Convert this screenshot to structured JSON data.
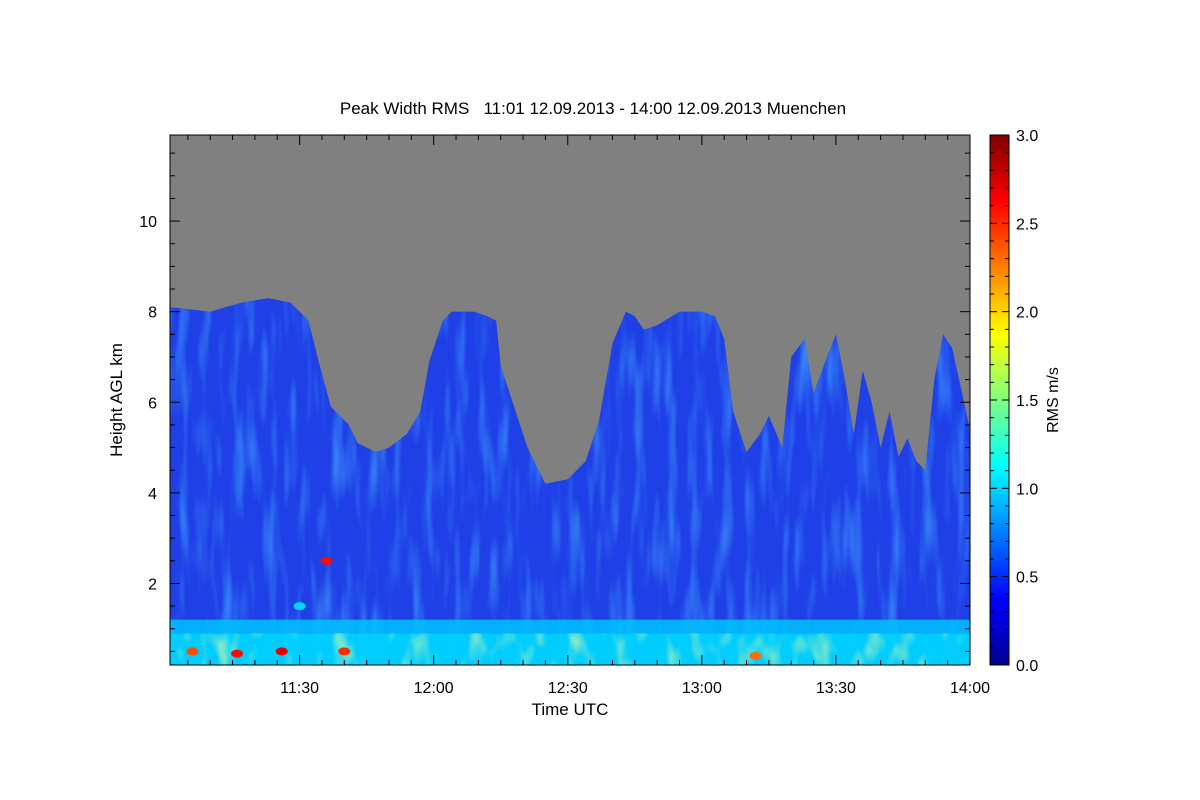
{
  "chart_data": {
    "type": "heatmap",
    "title": "Peak Width RMS   11:01 12.09.2013 - 14:00 12.09.2013 Muenchen",
    "xlabel": "Time UTC",
    "ylabel": "Height AGL km",
    "x_tick_labels": [
      "11:30",
      "12:00",
      "12:30",
      "13:00",
      "13:30",
      "14:00"
    ],
    "x_ticks_minutes": [
      690,
      720,
      750,
      780,
      810,
      840
    ],
    "xlim_minutes": [
      661,
      840
    ],
    "y_tick_labels": [
      "2",
      "4",
      "6",
      "8",
      "10"
    ],
    "y_ticks": [
      2,
      4,
      6,
      8,
      10
    ],
    "ylim": [
      0.2,
      11.9
    ],
    "colorbar": {
      "label": "RMS m/s",
      "tick_labels": [
        "0.0",
        "0.5",
        "1.0",
        "1.5",
        "2.0",
        "2.5",
        "3.0"
      ],
      "ticks": [
        0,
        0.5,
        1.0,
        1.5,
        2.0,
        2.5,
        3.0
      ],
      "range": [
        0,
        3.0
      ],
      "colormap": "jet"
    },
    "no_data_color": "#808080",
    "signal_top_profile": {
      "minutes": [
        661,
        670,
        677,
        683,
        688,
        692,
        694,
        697,
        701,
        703,
        707,
        710,
        714,
        717,
        719,
        722,
        724,
        727,
        729,
        732,
        734,
        735,
        738,
        741,
        745,
        750,
        754,
        757,
        760,
        763,
        765,
        767,
        770,
        775,
        780,
        783,
        785,
        787,
        790,
        793,
        795,
        798,
        800,
        803,
        805,
        808,
        810,
        812,
        814,
        816,
        818,
        820,
        822,
        824,
        826,
        828,
        830,
        832,
        834,
        836,
        838,
        840
      ],
      "top_km": [
        8.1,
        8.0,
        8.2,
        8.3,
        8.2,
        7.8,
        7.0,
        5.9,
        5.5,
        5.1,
        4.9,
        5.0,
        5.3,
        5.8,
        6.9,
        7.8,
        8.0,
        8.0,
        8.0,
        7.9,
        7.8,
        6.8,
        5.9,
        5.0,
        4.2,
        4.3,
        4.7,
        5.6,
        7.3,
        8.0,
        7.9,
        7.6,
        7.7,
        8.0,
        8.0,
        7.9,
        7.4,
        5.8,
        4.9,
        5.3,
        5.7,
        5.0,
        7.0,
        7.4,
        6.2,
        7.0,
        7.5,
        6.5,
        5.3,
        6.7,
        6.0,
        5.0,
        5.8,
        4.8,
        5.2,
        4.7,
        4.5,
        6.5,
        7.5,
        7.2,
        6.3,
        5.4
      ]
    },
    "layers": [
      {
        "name": "near-ground band",
        "height_km": [
          0.2,
          0.9
        ],
        "rms_range": [
          0.7,
          1.3
        ]
      },
      {
        "name": "boundary layer",
        "height_km": [
          0.9,
          1.2
        ],
        "rms_range": [
          0.8,
          1.1
        ]
      },
      {
        "name": "free troposphere",
        "height_km": [
          1.2,
          8.3
        ],
        "rms_range": [
          0.2,
          0.5
        ]
      }
    ],
    "hotspots": [
      {
        "time_min": 690,
        "height_km": 1.5,
        "rms": 1.0
      },
      {
        "time_min": 696,
        "height_km": 2.5,
        "rms": 2.6
      },
      {
        "time_min": 666,
        "height_km": 0.5,
        "rms": 2.4
      },
      {
        "time_min": 676,
        "height_km": 0.45,
        "rms": 2.6
      },
      {
        "time_min": 686,
        "height_km": 0.5,
        "rms": 2.7
      },
      {
        "time_min": 700,
        "height_km": 0.5,
        "rms": 2.5
      },
      {
        "time_min": 792,
        "height_km": 0.4,
        "rms": 2.3
      }
    ]
  }
}
